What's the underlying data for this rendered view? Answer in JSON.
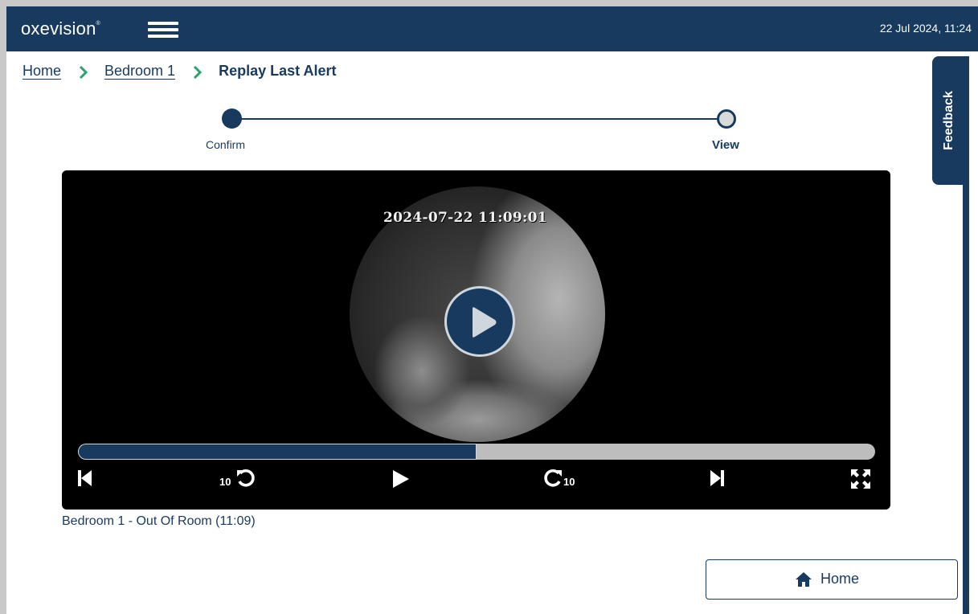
{
  "header": {
    "logo": "oxevision",
    "logo_mark": "®",
    "datetime": "22 Jul 2024, 11:24",
    "menu_icon": "hamburger-icon"
  },
  "breadcrumb": {
    "items": [
      "Home",
      "Bedroom 1"
    ],
    "current": "Replay Last Alert"
  },
  "feedback": {
    "label": "Feedback"
  },
  "stepper": {
    "steps": [
      "Confirm",
      "View"
    ],
    "active_index": 0
  },
  "player": {
    "video_timestamp": "2024-07-22  11:09:01",
    "progress_fraction": 0.5,
    "rewind_seconds": "10",
    "forward_seconds": "10"
  },
  "caption": "Bedroom 1 - Out Of Room (11:09)",
  "home_button": {
    "label": "Home",
    "icon": "home-icon"
  },
  "colors": {
    "primary": "#173a5e",
    "accent": "#27a36e",
    "track": "#bdbdbd"
  }
}
